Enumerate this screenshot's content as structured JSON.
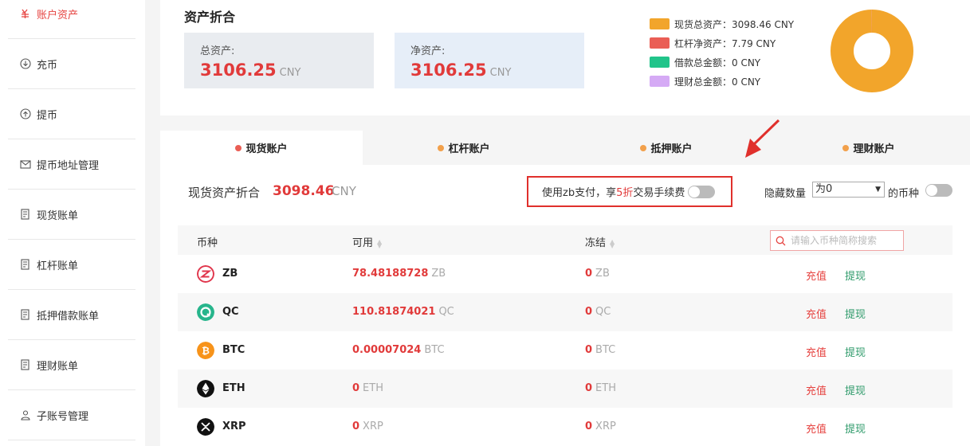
{
  "sidebar": {
    "items": [
      {
        "label": "账户资产",
        "icon": "wallet-icon",
        "active": true
      },
      {
        "label": "充币",
        "icon": "download-circle-icon"
      },
      {
        "label": "提币",
        "icon": "upload-circle-icon"
      },
      {
        "label": "提币地址管理",
        "icon": "envelope-icon"
      },
      {
        "label": "现货账单",
        "icon": "bill-icon"
      },
      {
        "label": "杠杆账单",
        "icon": "bill-icon"
      },
      {
        "label": "抵押借款账单",
        "icon": "bill-icon"
      },
      {
        "label": "理财账单",
        "icon": "bill-icon"
      },
      {
        "label": "子账号管理",
        "icon": "user-group-icon"
      }
    ]
  },
  "summary": {
    "title": "资产折合",
    "total_label": "总资产:",
    "total_value": "3106.25",
    "total_unit": "CNY",
    "net_label": "净资产:",
    "net_value": "3106.25",
    "net_unit": "CNY"
  },
  "legend": [
    {
      "label": "现货总资产：3098.46 CNY",
      "color": "#f2a52b"
    },
    {
      "label": "杠杆净资产：7.79 CNY",
      "color": "#ea5e55"
    },
    {
      "label": "借款总金额：0 CNY",
      "color": "#21c48a"
    },
    {
      "label": "理财总金额：0 CNY",
      "color": "#d5aaf5"
    }
  ],
  "donut": {
    "values": [
      3098.46,
      7.79,
      0,
      0
    ],
    "colors": [
      "#f2a52b",
      "#ea5e55",
      "#21c48a",
      "#d5aaf5"
    ]
  },
  "tabs": [
    {
      "label": "现货账户",
      "dot_color": "#ea5e55",
      "active": true
    },
    {
      "label": "杠杆账户",
      "dot_color": "#f2a04b"
    },
    {
      "label": "抵押账户",
      "dot_color": "#f2a04b"
    },
    {
      "label": "理财账户",
      "dot_color": "#f2a04b"
    }
  ],
  "spot": {
    "label": "现货资产折合",
    "value": "3098.46",
    "unit": "CNY"
  },
  "zb_pay": {
    "prefix": "使用zb支付，享",
    "highlight": "5折",
    "suffix": "交易手续费"
  },
  "hide": {
    "label": "隐藏数量",
    "selected": "为0",
    "suffix": "的币种"
  },
  "table": {
    "headers": {
      "coin": "币种",
      "available": "可用",
      "frozen": "冻结"
    },
    "search_placeholder": "请输入币种简称搜索",
    "deposit_label": "充值",
    "withdraw_label": "提现",
    "rows": [
      {
        "coin": "ZB",
        "icon_color": "#e0354b",
        "available": "78.48188728",
        "frozen": "0"
      },
      {
        "coin": "QC",
        "icon_color": "#27b58c",
        "available": "110.81874021",
        "frozen": "0"
      },
      {
        "coin": "BTC",
        "icon_color": "#f7931a",
        "available": "0.00007024",
        "frozen": "0"
      },
      {
        "coin": "ETH",
        "icon_color": "#111111",
        "available": "0",
        "frozen": "0"
      },
      {
        "coin": "XRP",
        "icon_color": "#111111",
        "available": "0",
        "frozen": "0"
      }
    ]
  }
}
